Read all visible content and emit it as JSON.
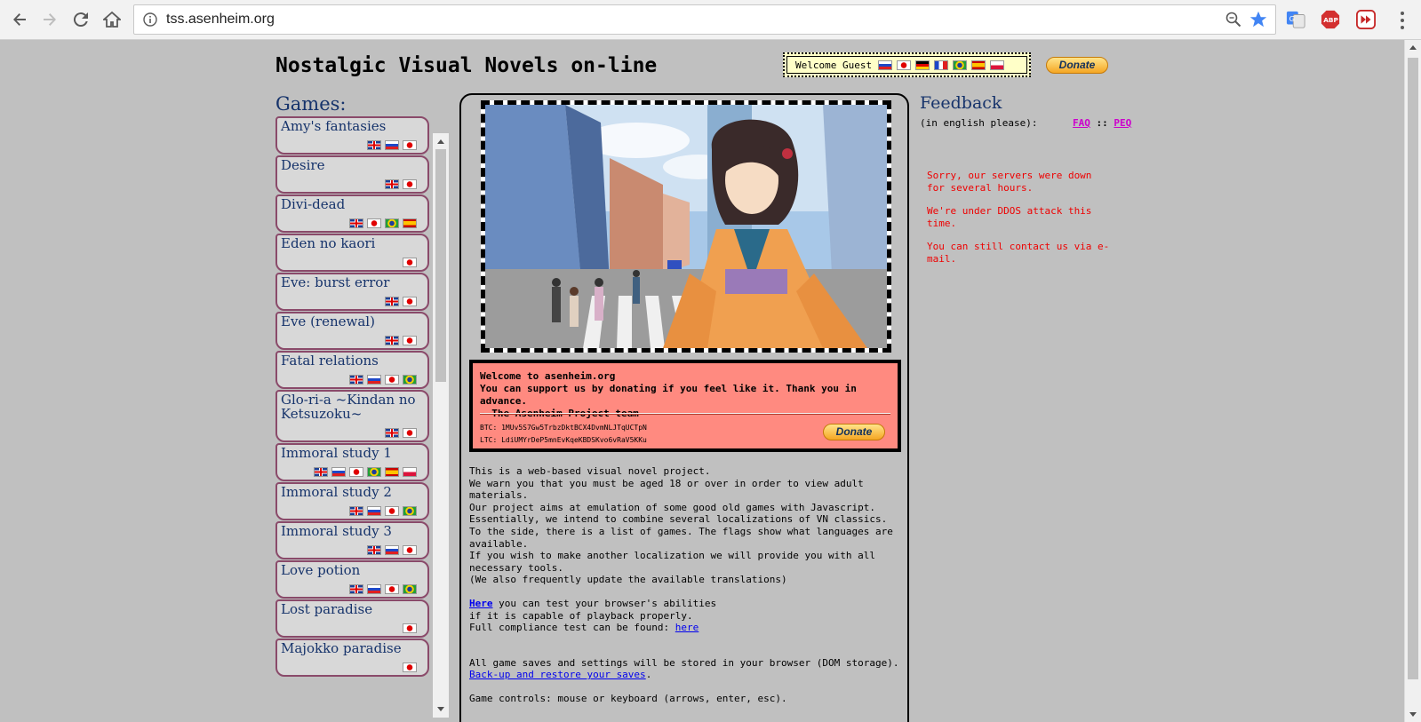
{
  "browser": {
    "url": "tss.asenheim.org"
  },
  "site": {
    "title": "Nostalgic Visual Novels on-line",
    "welcome_text": "Welcome Guest",
    "donate_label": "Donate"
  },
  "sidebar": {
    "heading": "Games:",
    "games": [
      {
        "name": "Amy's fantasies",
        "flags": [
          "en",
          "ru",
          "jp"
        ]
      },
      {
        "name": "Desire",
        "flags": [
          "en",
          "jp"
        ]
      },
      {
        "name": "Divi-dead",
        "flags": [
          "en",
          "jp",
          "br",
          "es"
        ]
      },
      {
        "name": "Eden no kaori",
        "flags": [
          "jp"
        ]
      },
      {
        "name": "Eve: burst error",
        "flags": [
          "en",
          "jp"
        ]
      },
      {
        "name": "Eve (renewal)",
        "flags": [
          "en",
          "jp"
        ]
      },
      {
        "name": "Fatal relations",
        "flags": [
          "en",
          "ru",
          "jp",
          "br"
        ]
      },
      {
        "name": "Glo-ri-a ~Kindan no Ketsuzoku~",
        "flags": [
          "en",
          "jp"
        ]
      },
      {
        "name": "Immoral study 1",
        "flags": [
          "en",
          "ru",
          "jp",
          "br",
          "es",
          "pl"
        ]
      },
      {
        "name": "Immoral study 2",
        "flags": [
          "en",
          "ru",
          "jp",
          "br"
        ]
      },
      {
        "name": "Immoral study 3",
        "flags": [
          "en",
          "ru",
          "jp"
        ]
      },
      {
        "name": "Love potion",
        "flags": [
          "en",
          "ru",
          "jp",
          "br"
        ]
      },
      {
        "name": "Lost paradise",
        "flags": [
          "jp"
        ]
      },
      {
        "name": "Majokko paradise",
        "flags": [
          "jp"
        ]
      }
    ]
  },
  "donation": {
    "line1": "Welcome to asenheim.org",
    "line2": "You can support us by donating if you feel like it. Thank you in advance.",
    "line3": "- The Asenheim Project team",
    "btc": "BTC: 1MUv5S7Gw5TrbzDktBCX4DvmNLJTqUCTpN",
    "ltc": "LTC: LdiUMYrDeP5mnEvKqeKBDSKvo6vRaV5KKu",
    "donate_label": "Donate"
  },
  "intro": {
    "lines": [
      "This is a web-based visual novel project.",
      "We warn you that you must be aged 18 or over in order to view adult",
      "materials.",
      "Our project aims at emulation of some good old games with Javascript.",
      "Essentially, we intend to combine several localizations of VN classics.",
      "To the side, there is a list of games. The flags show what languages are",
      "available.",
      "If you wish to make another localization we will provide you with all",
      "necessary tools.",
      "(We also frequently update the available translations)"
    ],
    "test_link": "Here",
    "test_text": " you can test your browser's abilities",
    "test_line2": "if it is capable of playback properly.",
    "compliance_text": "Full compliance test can be found: ",
    "compliance_link": "here",
    "saves_text": "All game saves and settings will be stored in your browser (DOM storage).",
    "saves_link": "Back-up and restore your saves",
    "saves_suffix": ".",
    "controls": "Game controls: mouse or keyboard (arrows, enter, esc)."
  },
  "feedback": {
    "title": "Feedback",
    "subtitle": "(in english please):",
    "faq": "FAQ",
    "sep": " :: ",
    "peq": "PEQ",
    "notice": [
      "Sorry, our servers were down for several hours.",
      "We're under DDOS attack this time.",
      "You can still contact us via e-mail."
    ]
  },
  "colors": {
    "heading": "#16336b",
    "notice": "#ee0000",
    "donate_panel": "#ff8a80",
    "link": "#0000ee",
    "faq_link": "#cc00cc"
  }
}
